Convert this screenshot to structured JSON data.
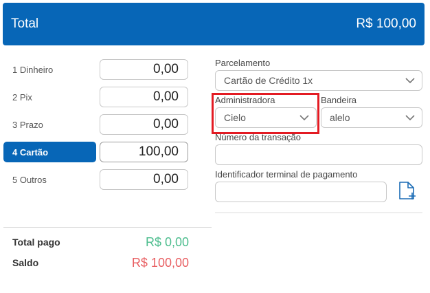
{
  "header": {
    "title": "Total",
    "amount": "R$ 100,00"
  },
  "methods": [
    {
      "label": "1 Dinheiro",
      "value": "0,00"
    },
    {
      "label": "2 Pix",
      "value": "0,00"
    },
    {
      "label": "3 Prazo",
      "value": "0,00"
    },
    {
      "label": "4 Cartão",
      "value": "100,00"
    },
    {
      "label": "5 Outros",
      "value": "0,00"
    }
  ],
  "summary": {
    "paid_label": "Total pago",
    "paid_value": "R$ 0,00",
    "balance_label": "Saldo",
    "balance_value": "R$ 100,00"
  },
  "form": {
    "installments_label": "Parcelamento",
    "installments_value": "Cartão de Crédito 1x",
    "administrator_label": "Administradora",
    "administrator_value": "Cielo",
    "brand_label": "Bandeira",
    "brand_value": "alelo",
    "transaction_label": "Número da transação",
    "transaction_value": "",
    "terminal_label": "Identificador terminal de pagamento",
    "terminal_value": ""
  },
  "colors": {
    "primary": "#0766b7",
    "paid": "#4dbd8e",
    "balance": "#e85f62",
    "highlight": "#e31b23"
  },
  "icons": {
    "chevron": "chevron-down-icon",
    "document_add": "document-add-icon"
  }
}
